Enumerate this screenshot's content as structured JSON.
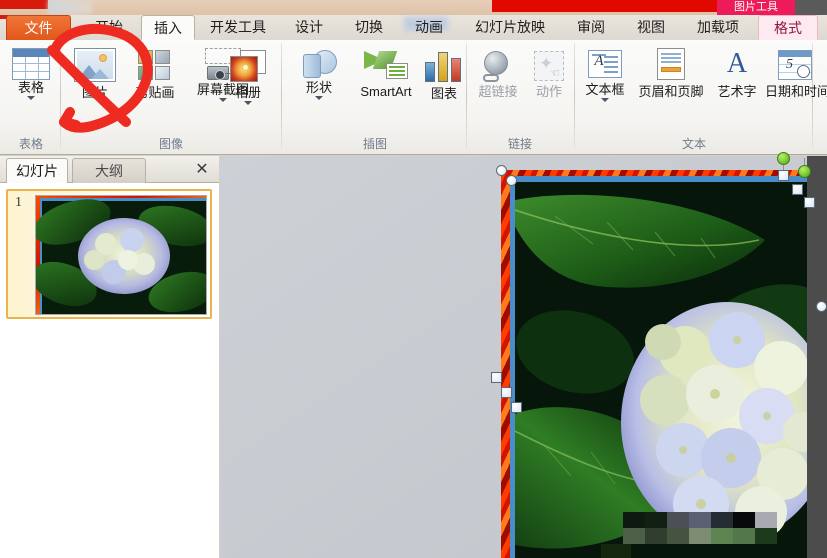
{
  "window": {
    "context_tab_title": "图片工具",
    "accent_orange": "#e2571b",
    "accent_red": "#e10800",
    "context_pink": "#ed1b5a"
  },
  "ribbon": {
    "tabs": [
      {
        "label": "文件",
        "state": "file"
      },
      {
        "label": "开始",
        "state": "idle"
      },
      {
        "label": "插入",
        "state": "active"
      },
      {
        "label": "开发工具",
        "state": "idle"
      },
      {
        "label": "设计",
        "state": "idle"
      },
      {
        "label": "切换",
        "state": "idle"
      },
      {
        "label": "动画",
        "state": "idle"
      },
      {
        "label": "幻灯片放映",
        "state": "idle"
      },
      {
        "label": "审阅",
        "state": "idle"
      },
      {
        "label": "视图",
        "state": "idle"
      },
      {
        "label": "加载项",
        "state": "idle"
      },
      {
        "label": "格式",
        "state": "ctx-active"
      }
    ],
    "groups": [
      {
        "name": "表格"
      },
      {
        "name": "图像"
      },
      {
        "name": "插图"
      },
      {
        "name": "链接"
      },
      {
        "name": "文本"
      }
    ],
    "buttons": {
      "table": {
        "label": "表格",
        "icon": "table-icon",
        "has_caret": true
      },
      "picture": {
        "label": "图片",
        "icon": "picture-icon",
        "has_caret": false
      },
      "clipart": {
        "label": "剪贴画",
        "icon": "clip-art-icon",
        "has_caret": false
      },
      "screenshot": {
        "label": "屏幕截图",
        "icon": "screenshot-icon",
        "has_caret": true
      },
      "photoalbum": {
        "label": "相册",
        "icon": "photo-album-icon",
        "has_caret": true
      },
      "shapes": {
        "label": "形状",
        "icon": "shapes-icon",
        "has_caret": true
      },
      "smartart": {
        "label": "SmartArt",
        "icon": "smartart-icon",
        "has_caret": false
      },
      "chart": {
        "label": "图表",
        "icon": "chart-icon",
        "has_caret": false
      },
      "hyperlink": {
        "label": "超链接",
        "icon": "hyperlink-globe-icon",
        "has_caret": false
      },
      "action": {
        "label": "动作",
        "icon": "action-icon",
        "has_caret": false
      },
      "textbox": {
        "label": "文本框",
        "icon": "text-box-icon",
        "has_caret": true
      },
      "headerfooter": {
        "label": "页眉和页脚",
        "icon": "header-footer-icon",
        "has_caret": false
      },
      "wordart": {
        "label": "艺术字",
        "icon": "word-art-icon",
        "has_caret": false
      },
      "datetime": {
        "label": "日期和时间",
        "icon": "date-time-icon",
        "has_caret": false
      }
    }
  },
  "annotation": {
    "shape": "hand-drawn-arrow-loop",
    "color": "#ee2b20",
    "target": "图片"
  },
  "left_pane": {
    "tabs": [
      {
        "label": "幻灯片",
        "state": "active"
      },
      {
        "label": "大纲",
        "state": "idle"
      }
    ],
    "close_glyph": "✕",
    "slides": [
      {
        "number": "1",
        "thumbnail": "hydrangea-flower-photo"
      }
    ]
  },
  "workspace": {
    "selected_object": "picture",
    "handles": {
      "rotate": "rotation-handle",
      "corner": "corner-resize-handle",
      "side": "side-resize-handle"
    }
  }
}
